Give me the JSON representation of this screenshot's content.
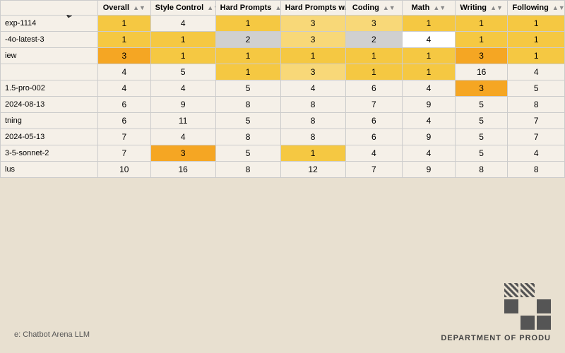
{
  "table": {
    "columns": [
      {
        "id": "model",
        "label": "",
        "sortable": false
      },
      {
        "id": "overall",
        "label": "Overall",
        "sortable": true
      },
      {
        "id": "style_control",
        "label": "Style Control",
        "sortable": true
      },
      {
        "id": "hard_prompts",
        "label": "Hard Prompts",
        "sortable": true
      },
      {
        "id": "hard_w_style",
        "label": "Hard Prompts w/ Style Control",
        "sortable": true
      },
      {
        "id": "coding",
        "label": "Coding",
        "sortable": true
      },
      {
        "id": "math",
        "label": "Math",
        "sortable": true
      },
      {
        "id": "writing",
        "label": "Writing",
        "sortable": true
      },
      {
        "id": "following",
        "label": "Following",
        "sortable": true
      }
    ],
    "rows": [
      {
        "model": "exp-1114",
        "overall": "1",
        "style_control": "4",
        "hard_prompts": "1",
        "hard_w_style": "3",
        "coding": "3",
        "math": "1",
        "writing": "1",
        "following": "1",
        "heat": {
          "overall": "heat-1",
          "style_control": "",
          "hard_prompts": "heat-1",
          "hard_w_style": "heat-2",
          "coding": "heat-2",
          "math": "heat-1",
          "writing": "heat-1",
          "following": "heat-1"
        }
      },
      {
        "model": "-4o-latest-3",
        "overall": "1",
        "style_control": "1",
        "hard_prompts": "2",
        "hard_w_style": "3",
        "coding": "2",
        "math": "4",
        "writing": "1",
        "following": "1",
        "heat": {
          "overall": "heat-1",
          "style_control": "heat-1",
          "hard_prompts": "heat-gray",
          "hard_w_style": "heat-2",
          "coding": "heat-gray",
          "math": "heat-white",
          "writing": "heat-1",
          "following": "heat-1"
        }
      },
      {
        "model": "iew",
        "overall": "3",
        "style_control": "1",
        "hard_prompts": "1",
        "hard_w_style": "1",
        "coding": "1",
        "math": "1",
        "writing": "3",
        "following": "1",
        "heat": {
          "overall": "heat-orange",
          "style_control": "heat-1",
          "hard_prompts": "heat-1",
          "hard_w_style": "heat-1",
          "coding": "heat-1",
          "math": "heat-1",
          "writing": "heat-orange",
          "following": "heat-1"
        }
      },
      {
        "model": "",
        "overall": "4",
        "style_control": "5",
        "hard_prompts": "1",
        "hard_w_style": "3",
        "coding": "1",
        "math": "1",
        "writing": "16",
        "following": "4",
        "heat": {
          "overall": "",
          "style_control": "",
          "hard_prompts": "heat-1",
          "hard_w_style": "heat-2",
          "coding": "heat-1",
          "math": "heat-1",
          "writing": "",
          "following": ""
        }
      },
      {
        "model": "1.5-pro-002",
        "overall": "4",
        "style_control": "4",
        "hard_prompts": "5",
        "hard_w_style": "4",
        "coding": "6",
        "math": "4",
        "writing": "3",
        "following": "5",
        "heat": {
          "overall": "",
          "style_control": "",
          "hard_prompts": "",
          "hard_w_style": "",
          "coding": "",
          "math": "",
          "writing": "heat-orange",
          "following": ""
        }
      },
      {
        "model": "2024-08-13",
        "overall": "6",
        "style_control": "9",
        "hard_prompts": "8",
        "hard_w_style": "8",
        "coding": "7",
        "math": "9",
        "writing": "5",
        "following": "8",
        "heat": {
          "overall": "",
          "style_control": "",
          "hard_prompts": "",
          "hard_w_style": "",
          "coding": "",
          "math": "",
          "writing": "",
          "following": ""
        }
      },
      {
        "model": "tning",
        "overall": "6",
        "style_control": "11",
        "hard_prompts": "5",
        "hard_w_style": "8",
        "coding": "6",
        "math": "4",
        "writing": "5",
        "following": "7",
        "heat": {
          "overall": "",
          "style_control": "",
          "hard_prompts": "",
          "hard_w_style": "",
          "coding": "",
          "math": "",
          "writing": "",
          "following": ""
        }
      },
      {
        "model": "2024-05-13",
        "overall": "7",
        "style_control": "4",
        "hard_prompts": "8",
        "hard_w_style": "8",
        "coding": "6",
        "math": "9",
        "writing": "5",
        "following": "7",
        "heat": {
          "overall": "",
          "style_control": "",
          "hard_prompts": "",
          "hard_w_style": "",
          "coding": "",
          "math": "",
          "writing": "",
          "following": ""
        }
      },
      {
        "model": "3-5-sonnet-2",
        "overall": "7",
        "style_control": "3",
        "hard_prompts": "5",
        "hard_w_style": "1",
        "coding": "4",
        "math": "4",
        "writing": "5",
        "following": "4",
        "heat": {
          "overall": "",
          "style_control": "heat-orange",
          "hard_prompts": "",
          "hard_w_style": "heat-1",
          "coding": "",
          "math": "",
          "writing": "",
          "following": ""
        }
      },
      {
        "model": "lus",
        "overall": "10",
        "style_control": "16",
        "hard_prompts": "8",
        "hard_w_style": "12",
        "coding": "7",
        "math": "9",
        "writing": "8",
        "following": "8",
        "heat": {
          "overall": "",
          "style_control": "",
          "hard_prompts": "",
          "hard_w_style": "",
          "coding": "",
          "math": "",
          "writing": "",
          "following": ""
        }
      }
    ]
  },
  "footer": {
    "source_label": "e: Chatbot Arena LLM",
    "dept_label": "DEPARTMENT OF PRODU"
  },
  "arrow": "↙"
}
